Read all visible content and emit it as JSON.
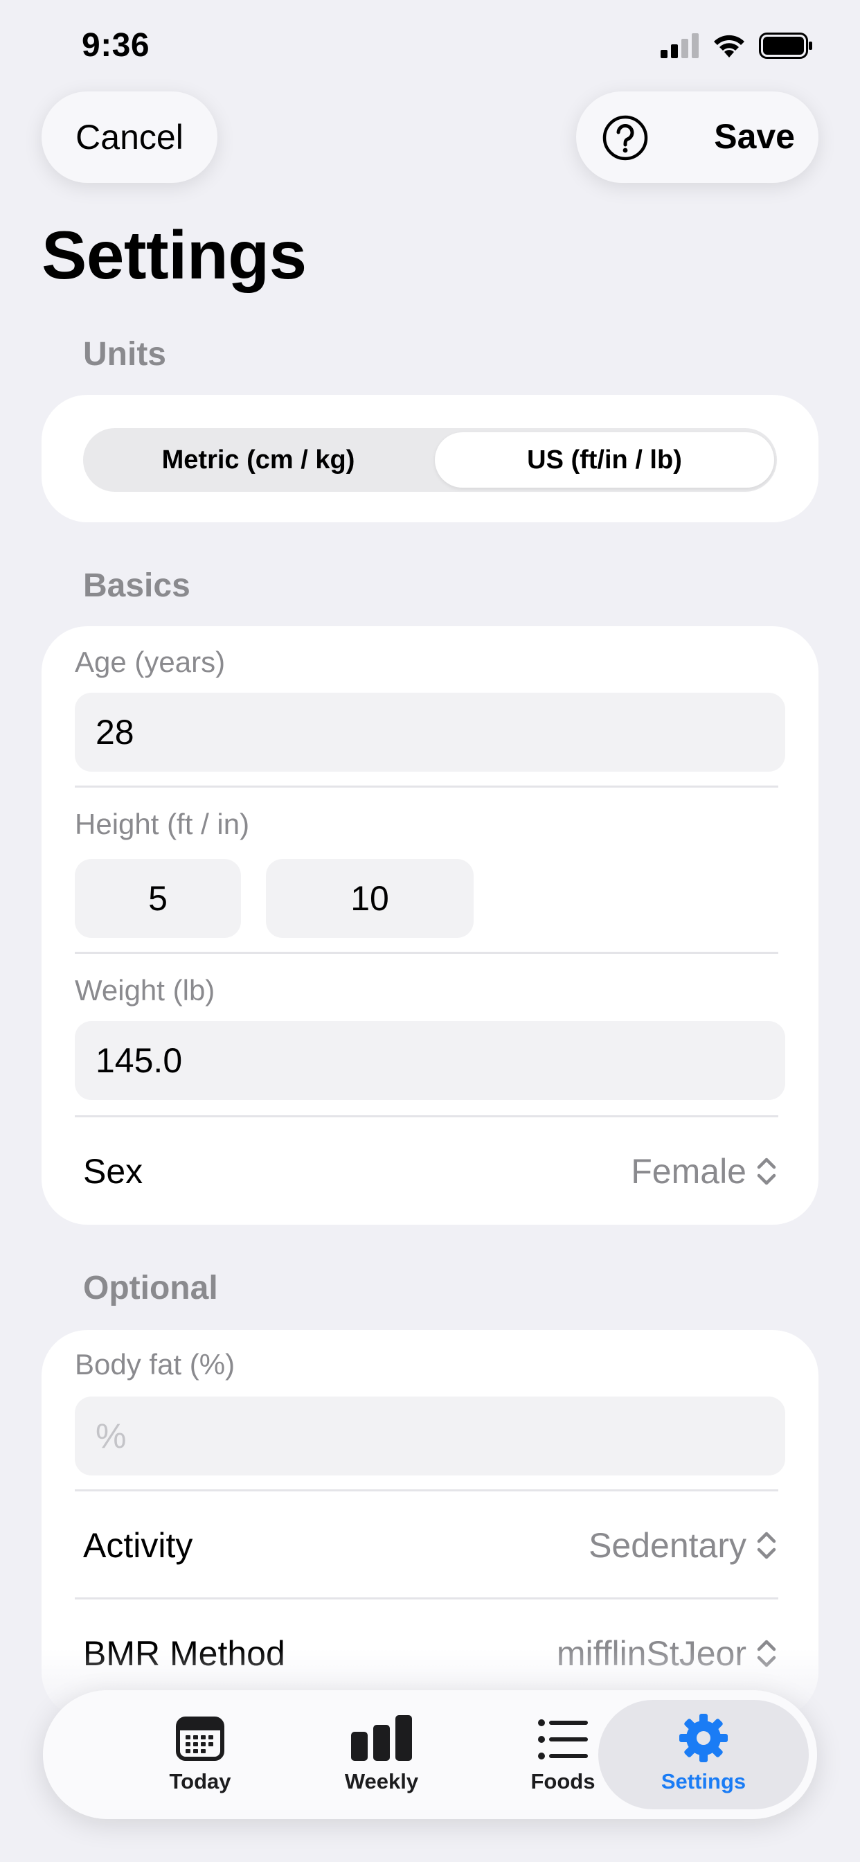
{
  "status": {
    "time": "9:36"
  },
  "toolbar": {
    "cancel_label": "Cancel",
    "save_label": "Save"
  },
  "page": {
    "title": "Settings"
  },
  "units": {
    "header": "Units",
    "options": [
      "Metric (cm / kg)",
      "US (ft/in / lb)"
    ],
    "selected": "US (ft/in / lb)"
  },
  "basics": {
    "header": "Basics",
    "age": {
      "label": "Age (years)",
      "value": "28"
    },
    "height": {
      "label": "Height (ft / in)",
      "feet": "5",
      "inches": "10"
    },
    "weight": {
      "label": "Weight (lb)",
      "value": "145.0"
    },
    "sex": {
      "label": "Sex",
      "value": "Female"
    }
  },
  "optional": {
    "header": "Optional",
    "body_fat": {
      "label": "Body fat (%)",
      "placeholder": "%"
    },
    "activity": {
      "label": "Activity",
      "value": "Sedentary"
    },
    "bmr": {
      "label": "BMR Method",
      "value": "mifflinStJeor"
    }
  },
  "tabs": [
    {
      "label": "Today",
      "icon": "calendar-icon"
    },
    {
      "label": "Weekly",
      "icon": "bar-chart-icon"
    },
    {
      "label": "Foods",
      "icon": "list-icon"
    },
    {
      "label": "Settings",
      "icon": "gear-icon"
    }
  ],
  "colors": {
    "accent": "#1a7cf5",
    "secondary_text": "#8a8a8e",
    "background": "#f0f0f5"
  }
}
